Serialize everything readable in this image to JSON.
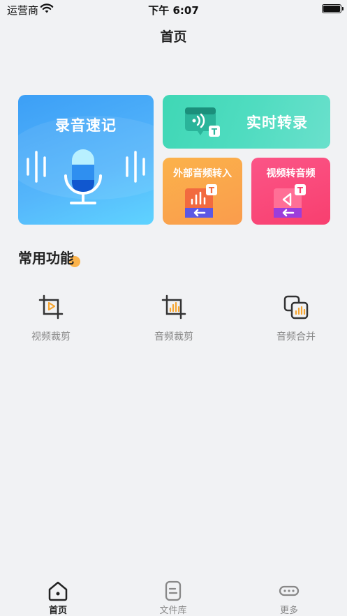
{
  "status_bar": {
    "carrier": "运营商",
    "time": "下午 6:07"
  },
  "header": {
    "title": "首页"
  },
  "cards": {
    "record": {
      "label": "录音速记",
      "icon": "microphone-icon"
    },
    "live": {
      "label": "实时转录",
      "icon": "transcribe-icon"
    },
    "import": {
      "label": "外部音频转入",
      "icon": "audio-import-icon"
    },
    "video_to_audio": {
      "label": "视频转音频",
      "icon": "video-to-audio-icon"
    }
  },
  "section": {
    "title": "常用功能"
  },
  "features": [
    {
      "label": "视频裁剪",
      "icon": "video-crop-icon"
    },
    {
      "label": "音频裁剪",
      "icon": "audio-crop-icon"
    },
    {
      "label": "音频合并",
      "icon": "audio-merge-icon"
    }
  ],
  "tabbar": [
    {
      "label": "首页",
      "icon": "home-icon",
      "active": true
    },
    {
      "label": "文件库",
      "icon": "file-library-icon",
      "active": false
    },
    {
      "label": "更多",
      "icon": "more-icon",
      "active": false
    }
  ],
  "colors": {
    "background": "#f1f2f4",
    "record_card": "#4aaaf8",
    "live_card": "#4fdcc0",
    "import_card": "#fba54b",
    "video_card": "#fa4a7b",
    "accent_dot": "#fbb34b",
    "icon_orange": "#f6a530"
  }
}
